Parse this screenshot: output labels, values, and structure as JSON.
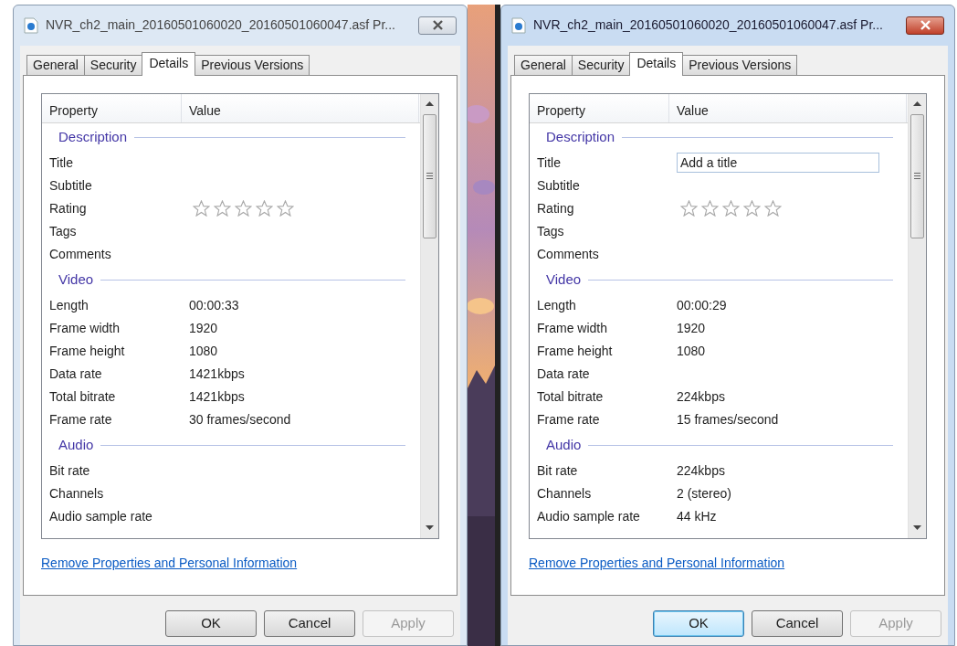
{
  "dialogs": [
    {
      "title": "NVR_ch2_main_20160501060020_20160501060047.asf Pr...",
      "active": false,
      "tabs": [
        {
          "label": "General",
          "selected": false
        },
        {
          "label": "Security",
          "selected": false
        },
        {
          "label": "Details",
          "selected": true
        },
        {
          "label": "Previous Versions",
          "selected": false
        }
      ],
      "columns": [
        "Property",
        "Value"
      ],
      "groups": [
        {
          "title": "Description",
          "rows": [
            {
              "kind": "text",
              "property": "Title"
            },
            {
              "kind": "text",
              "property": "Subtitle"
            },
            {
              "kind": "stars",
              "property": "Rating",
              "stars": 0
            },
            {
              "kind": "text",
              "property": "Tags"
            },
            {
              "kind": "text",
              "property": "Comments"
            }
          ]
        },
        {
          "title": "Video",
          "rows": [
            {
              "kind": "text",
              "property": "Length",
              "value": "00:00:33"
            },
            {
              "kind": "text",
              "property": "Frame width",
              "value": "1920"
            },
            {
              "kind": "text",
              "property": "Frame height",
              "value": "1080"
            },
            {
              "kind": "text",
              "property": "Data rate",
              "value": "1421kbps"
            },
            {
              "kind": "text",
              "property": "Total bitrate",
              "value": "1421kbps"
            },
            {
              "kind": "text",
              "property": "Frame rate",
              "value": "30 frames/second"
            }
          ]
        },
        {
          "title": "Audio",
          "rows": [
            {
              "kind": "text",
              "property": "Bit rate"
            },
            {
              "kind": "text",
              "property": "Channels"
            },
            {
              "kind": "text",
              "property": "Audio sample rate"
            }
          ]
        }
      ],
      "link": "Remove Properties and Personal Information",
      "buttons": [
        {
          "label": "OK",
          "disabled": false
        },
        {
          "label": "Cancel",
          "disabled": false
        },
        {
          "label": "Apply",
          "disabled": true
        }
      ]
    },
    {
      "title": "NVR_ch2_main_20160501060020_20160501060047.asf Pr...",
      "active": true,
      "tabs": [
        {
          "label": "General",
          "selected": false
        },
        {
          "label": "Security",
          "selected": false
        },
        {
          "label": "Details",
          "selected": true
        },
        {
          "label": "Previous Versions",
          "selected": false
        }
      ],
      "columns": [
        "Property",
        "Value"
      ],
      "groups": [
        {
          "title": "Description",
          "rows": [
            {
              "kind": "field",
              "property": "Title",
              "placeholder": "Add a title"
            },
            {
              "kind": "text",
              "property": "Subtitle"
            },
            {
              "kind": "stars",
              "property": "Rating",
              "stars": 0
            },
            {
              "kind": "text",
              "property": "Tags"
            },
            {
              "kind": "text",
              "property": "Comments"
            }
          ]
        },
        {
          "title": "Video",
          "rows": [
            {
              "kind": "text",
              "property": "Length",
              "value": "00:00:29"
            },
            {
              "kind": "text",
              "property": "Frame width",
              "value": "1920"
            },
            {
              "kind": "text",
              "property": "Frame height",
              "value": "1080"
            },
            {
              "kind": "text",
              "property": "Data rate"
            },
            {
              "kind": "text",
              "property": "Total bitrate",
              "value": "224kbps"
            },
            {
              "kind": "text",
              "property": "Frame rate",
              "value": "15 frames/second"
            }
          ]
        },
        {
          "title": "Audio",
          "rows": [
            {
              "kind": "text",
              "property": "Bit rate",
              "value": "224kbps"
            },
            {
              "kind": "text",
              "property": "Channels",
              "value": "2 (stereo)"
            },
            {
              "kind": "text",
              "property": "Audio sample rate",
              "value": "44 kHz"
            }
          ]
        }
      ],
      "link": "Remove Properties and Personal Information",
      "buttons": [
        {
          "label": "OK",
          "disabled": false
        },
        {
          "label": "Cancel",
          "disabled": false
        },
        {
          "label": "Apply",
          "disabled": true
        }
      ]
    }
  ]
}
